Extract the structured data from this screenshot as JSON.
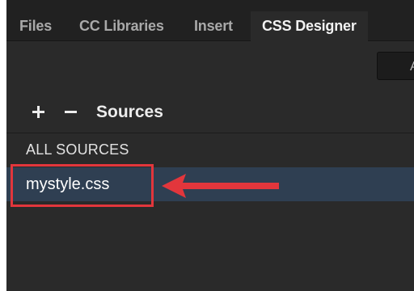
{
  "tabs": [
    {
      "label": "Files",
      "active": false
    },
    {
      "label": "CC Libraries",
      "active": false
    },
    {
      "label": "Insert",
      "active": false
    },
    {
      "label": "CSS Designer",
      "active": true
    }
  ],
  "toolbar": {
    "button_label": "A"
  },
  "sources": {
    "title": "Sources",
    "add_icon": "plus-icon",
    "remove_icon": "minus-icon",
    "all_label": "ALL SOURCES",
    "items": [
      {
        "label": "mystyle.css",
        "selected": true
      }
    ]
  },
  "annotation": {
    "color": "#e2363c"
  },
  "colors": {
    "selection": "#2f3f52",
    "panel": "#2a2a2a",
    "tabbar": "#212121"
  }
}
